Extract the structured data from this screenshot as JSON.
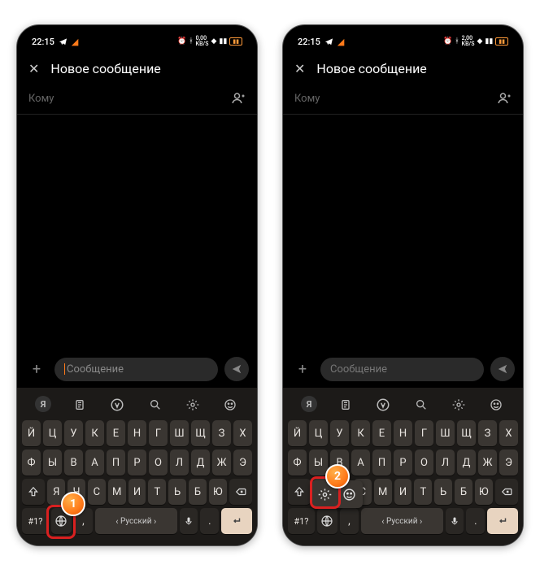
{
  "status": {
    "time": "22:15",
    "net": "0,00",
    "net2": "2,00",
    "unit": "KB/S"
  },
  "header": {
    "title": "Новое сообщение"
  },
  "to": {
    "label": "Кому"
  },
  "compose": {
    "placeholder": "Сообщение"
  },
  "keyboard": {
    "row1": [
      "Й",
      "Ц",
      "У",
      "К",
      "Е",
      "Н",
      "Г",
      "Ш",
      "Щ",
      "З",
      "Х"
    ],
    "row2": [
      "Ф",
      "Ы",
      "В",
      "А",
      "П",
      "Р",
      "О",
      "Л",
      "Д",
      "Ж",
      "Э"
    ],
    "row3": [
      "Я",
      "Ч",
      "С",
      "М",
      "И",
      "Т",
      "Ь",
      "Б",
      "Ю"
    ],
    "sym": "#1?",
    "lang": "Русский"
  },
  "badges": {
    "one": "1",
    "two": "2"
  }
}
